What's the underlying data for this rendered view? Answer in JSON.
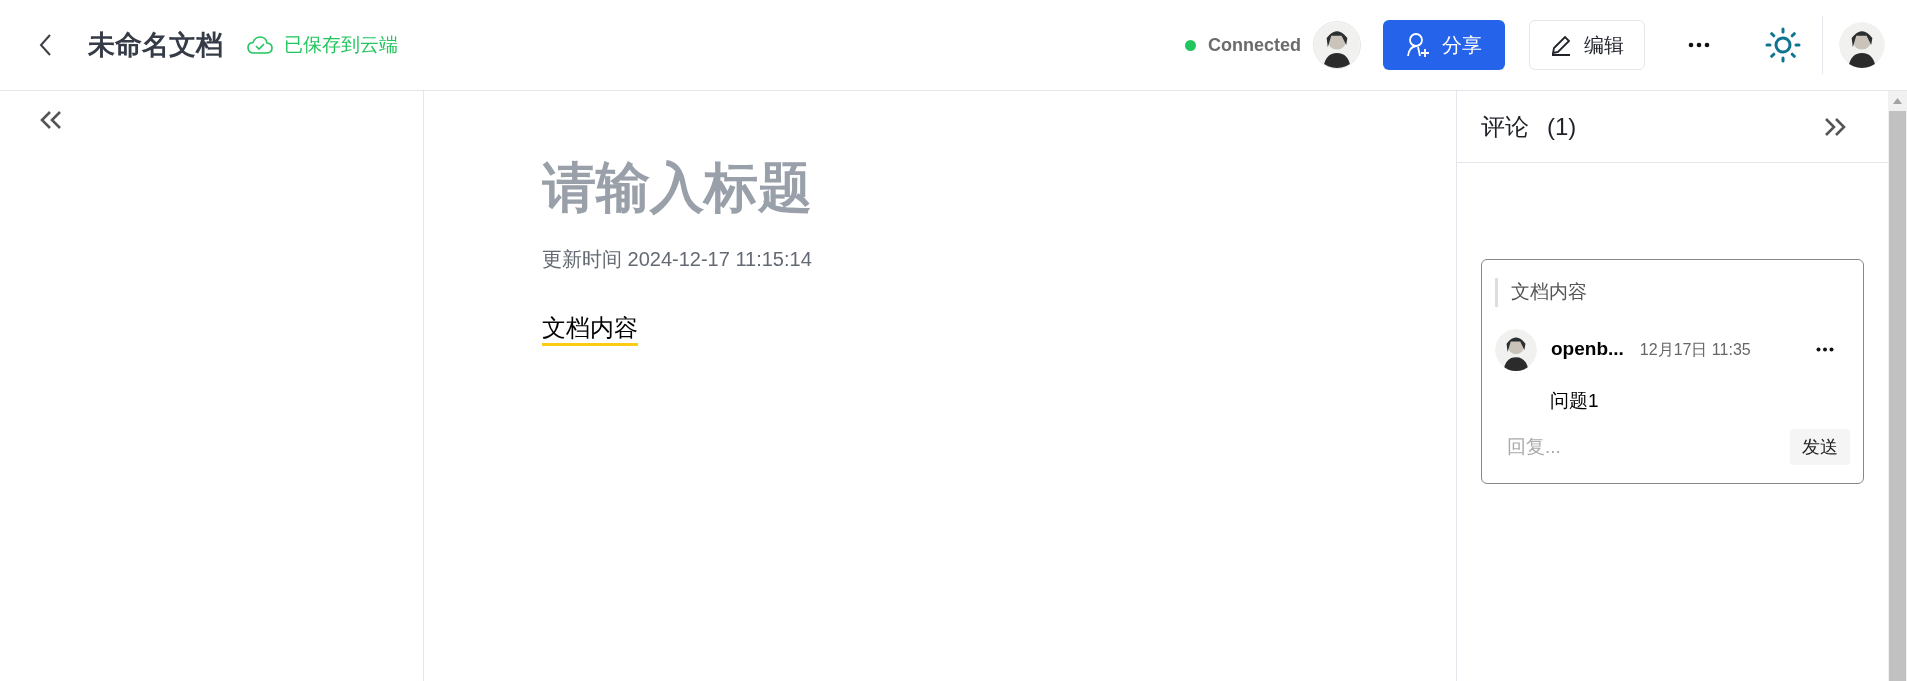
{
  "header": {
    "title": "未命名文档",
    "save_status": "已保存到云端",
    "connection": {
      "label": "Connected",
      "connected": true
    },
    "share_button": "分享",
    "edit_button": "编辑"
  },
  "editor": {
    "title_placeholder": "请输入标题",
    "updated": "更新时间 2024-12-17 11:15:14",
    "content": "文档内容",
    "content_commented": true
  },
  "comments": {
    "title": "评论",
    "count": "(1)",
    "threads": [
      {
        "quote": "文档内容",
        "author": "openb...",
        "time": "12月17日 11:35",
        "text": "问题1",
        "reply_placeholder": "回复...",
        "send_button": "发送"
      }
    ]
  }
}
